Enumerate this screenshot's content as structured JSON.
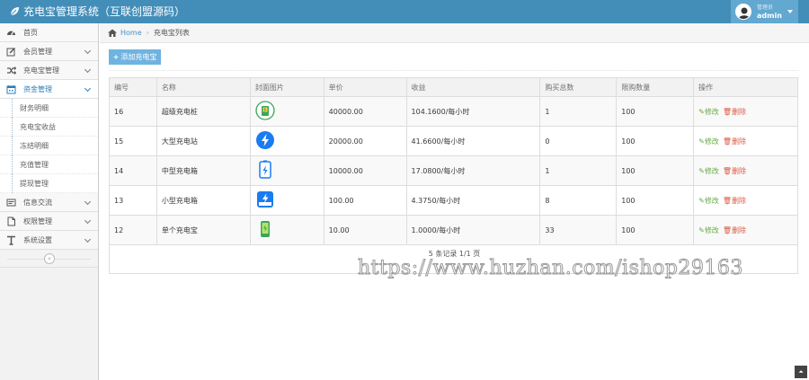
{
  "header": {
    "title": "充电宝管理系统（互联创盟源码）",
    "user_role": "管理员",
    "user_name": "admin"
  },
  "sidebar": {
    "items": [
      {
        "label": "首页",
        "icon": "dashboard-icon"
      },
      {
        "label": "会员管理",
        "icon": "edit-icon"
      },
      {
        "label": "充电宝管理",
        "icon": "shuffle-icon"
      },
      {
        "label": "资金管理",
        "icon": "calendar-icon"
      },
      {
        "label": "信息交流",
        "icon": "card-icon"
      },
      {
        "label": "权限管理",
        "icon": "file-icon"
      },
      {
        "label": "系统设置",
        "icon": "text-icon"
      }
    ],
    "sub_items": [
      "财务明细",
      "充电宝收益",
      "冻结明细",
      "充值管理",
      "提现管理"
    ],
    "collapse": "«"
  },
  "breadcrumb": {
    "home": "Home",
    "current": "充电宝列表"
  },
  "toolbar": {
    "add_label": "添加充电宝"
  },
  "table": {
    "headers": [
      "编号",
      "名称",
      "封面图片",
      "单价",
      "收益",
      "购买总数",
      "限购数量",
      "操作"
    ],
    "rows": [
      {
        "id": "16",
        "name": "超级充电桩",
        "price": "40000.00",
        "income": "104.1600/每小时",
        "total": "1",
        "limit": "100"
      },
      {
        "id": "15",
        "name": "大型充电站",
        "price": "20000.00",
        "income": "41.6600/每小时",
        "total": "0",
        "limit": "100"
      },
      {
        "id": "14",
        "name": "中型充电箱",
        "price": "10000.00",
        "income": "17.0800/每小时",
        "total": "1",
        "limit": "100"
      },
      {
        "id": "13",
        "name": "小型充电箱",
        "price": "100.00",
        "income": "4.3750/每小时",
        "total": "8",
        "limit": "100"
      },
      {
        "id": "12",
        "name": "单个充电宝",
        "price": "10.00",
        "income": "1.0000/每小时",
        "total": "33",
        "limit": "100"
      }
    ],
    "edit_label": "修改",
    "delete_label": "删除",
    "pager": "5 条记录 1/1 页"
  },
  "watermark": "https://www.huzhan.com/ishop29163",
  "colors": {
    "topbar": "#438eb9",
    "accent": "#2b7dbc",
    "button": "#6fb3e0",
    "edit": "#69aa46",
    "delete": "#dd5a43"
  }
}
